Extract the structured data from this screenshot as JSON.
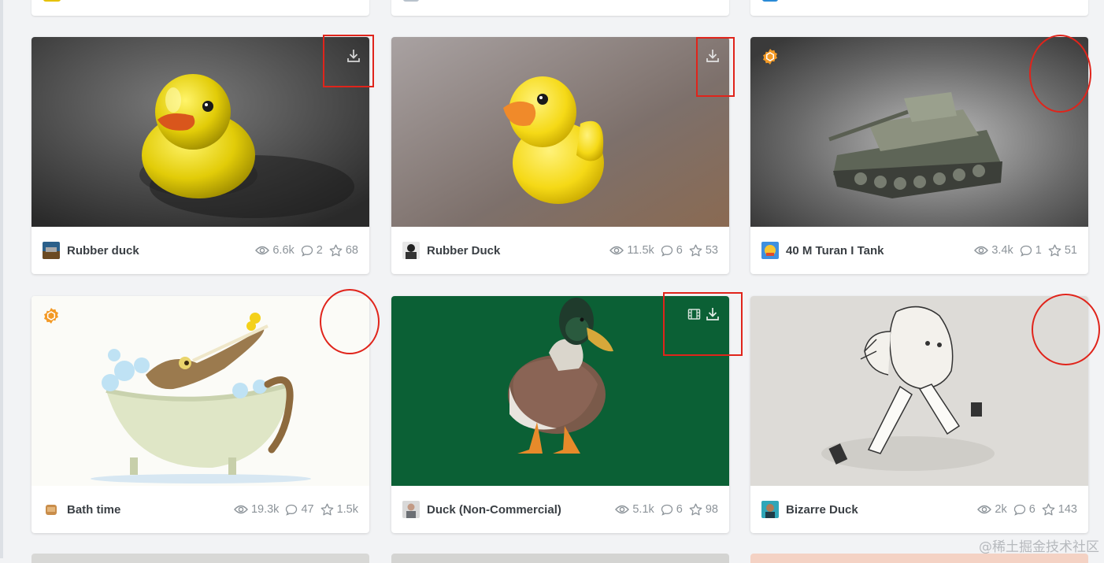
{
  "cards": [
    {
      "title": "Rubber duck",
      "views": "6.6k",
      "comments": "2",
      "likes": "68"
    },
    {
      "title": "Rubber Duck",
      "views": "11.5k",
      "comments": "6",
      "likes": "53"
    },
    {
      "title": "40 M Turan I Tank",
      "views": "3.4k",
      "comments": "1",
      "likes": "51"
    },
    {
      "title": "Bath time",
      "views": "19.3k",
      "comments": "47",
      "likes": "1.5k"
    },
    {
      "title": "Duck (Non-Commercial)",
      "views": "5.1k",
      "comments": "6",
      "likes": "98"
    },
    {
      "title": "Bizarre Duck",
      "views": "2k",
      "comments": "6",
      "likes": "143"
    }
  ],
  "icons": {
    "download": "download-icon",
    "view_3d": "film-icon",
    "staff_pick": "staff-pick-badge-icon",
    "views": "eye-icon",
    "comments": "comment-icon",
    "likes": "star-icon"
  },
  "colors": {
    "annotation": "#e0241b",
    "badge": "#f39a26",
    "text": "#3a3f44",
    "muted": "#8c9399"
  },
  "watermark": "@稀土掘金技术社区"
}
